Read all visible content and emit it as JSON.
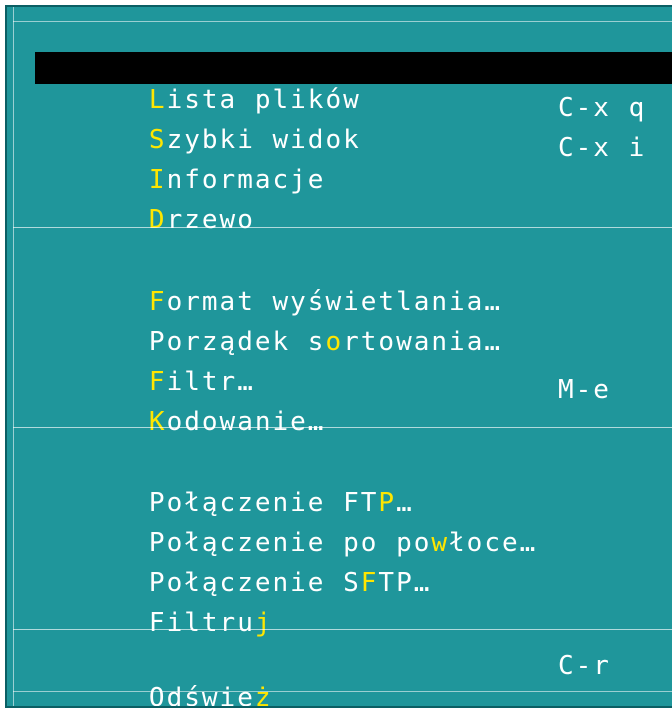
{
  "menu": {
    "title": "",
    "items": [
      {
        "before": "",
        "hotkey": "L",
        "after": "ista plików",
        "shortcut": "",
        "selected": true
      },
      {
        "before": "",
        "hotkey": "S",
        "after": "zybki widok",
        "shortcut": "C-x q",
        "selected": false
      },
      {
        "before": "",
        "hotkey": "I",
        "after": "nformacje",
        "shortcut": "C-x i",
        "selected": false
      },
      {
        "before": "",
        "hotkey": "D",
        "after": "rzewo",
        "shortcut": "",
        "selected": false
      },
      {
        "before": "",
        "hotkey": "F",
        "after": "ormat wyświetlania…",
        "shortcut": "",
        "selected": false
      },
      {
        "before": "Porządek s",
        "hotkey": "o",
        "after": "rtowania…",
        "shortcut": "",
        "selected": false
      },
      {
        "before": "",
        "hotkey": "F",
        "after": "iltr…",
        "shortcut": "",
        "selected": false
      },
      {
        "before": "",
        "hotkey": "K",
        "after": "odowanie…",
        "shortcut": "M-e",
        "selected": false
      },
      {
        "before": "Połączenie FT",
        "hotkey": "P",
        "after": "…",
        "shortcut": "",
        "selected": false
      },
      {
        "before": "Połączenie po po",
        "hotkey": "w",
        "after": "łoce…",
        "shortcut": "",
        "selected": false
      },
      {
        "before": "Połączenie S",
        "hotkey": "F",
        "after": "TP…",
        "shortcut": "",
        "selected": false
      },
      {
        "before": "Filtru",
        "hotkey": "j",
        "after": "",
        "shortcut": "",
        "selected": false
      },
      {
        "before": "Odświe",
        "hotkey": "ż",
        "after": "",
        "shortcut": "C-r",
        "selected": false
      }
    ]
  },
  "colors": {
    "background": "#1f969b",
    "text": "#ffffff",
    "hotkey": "#ffe600",
    "selected_background": "#000000"
  }
}
